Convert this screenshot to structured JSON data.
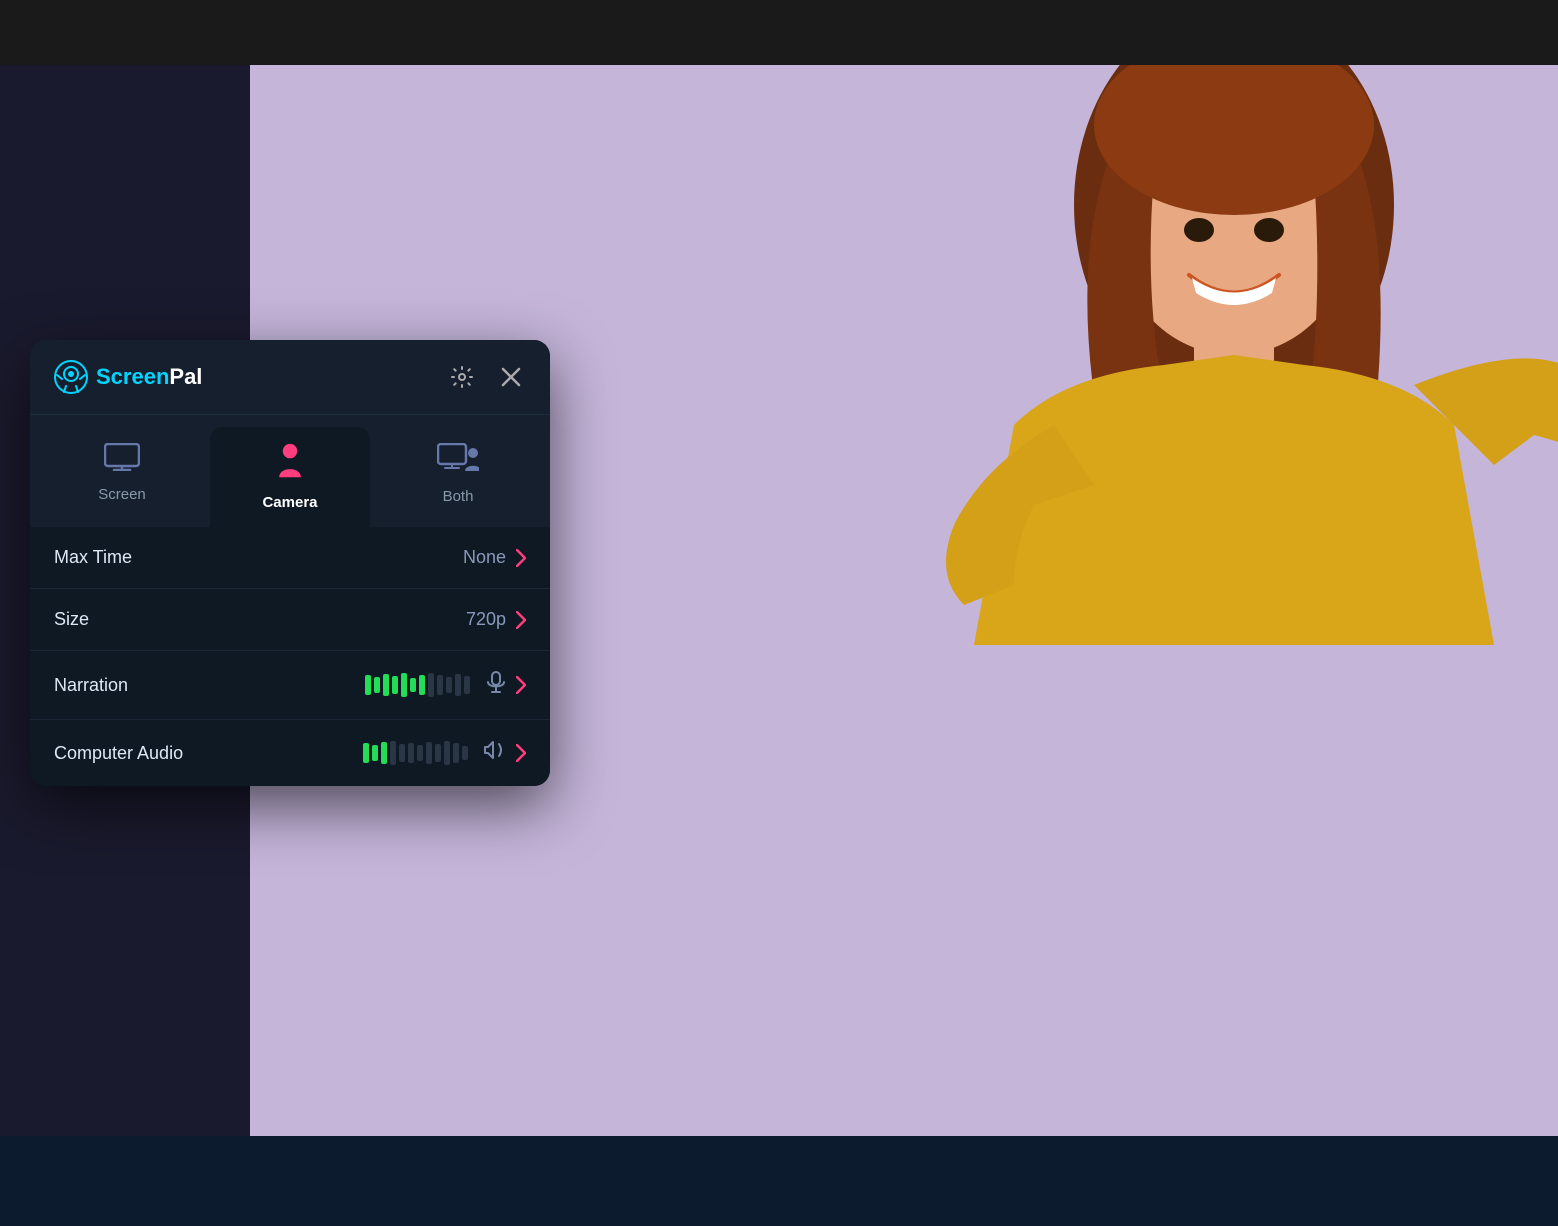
{
  "app": {
    "title": "ScreenPal",
    "logo_screen": "Screen",
    "logo_pal": "Pal"
  },
  "header": {
    "settings_icon": "⚙",
    "close_icon": "✕"
  },
  "tabs": [
    {
      "id": "screen",
      "label": "Screen",
      "active": false
    },
    {
      "id": "camera",
      "label": "Camera",
      "active": true
    },
    {
      "id": "both",
      "label": "Both",
      "active": false
    }
  ],
  "settings": [
    {
      "label": "Max Time",
      "value": "None",
      "has_bars": false
    },
    {
      "label": "Size",
      "value": "720p",
      "has_bars": false
    },
    {
      "label": "Narration",
      "value": "",
      "has_bars": true,
      "bars_green": 7,
      "bars_total": 12,
      "icon": "mic"
    },
    {
      "label": "Computer Audio",
      "value": "",
      "has_bars": true,
      "bars_green": 3,
      "bars_total": 12,
      "icon": "speaker"
    }
  ],
  "colors": {
    "accent_pink": "#ff3d7f",
    "accent_cyan": "#00d4ff",
    "panel_bg": "#0f1923",
    "header_bg": "#161f2e",
    "bar_green": "#22dd55",
    "bar_dark": "#2a3545"
  }
}
